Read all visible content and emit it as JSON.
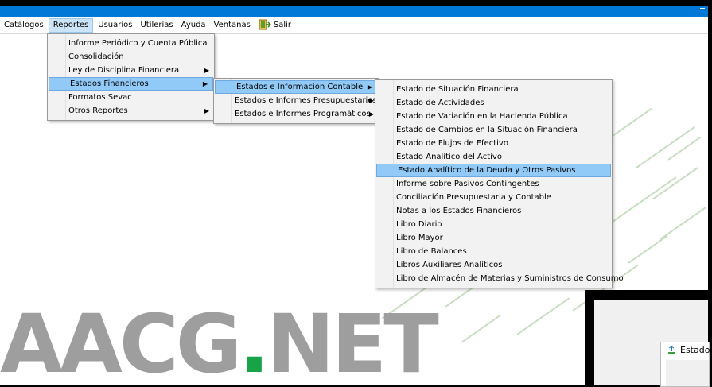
{
  "menubar": {
    "items": [
      "Catálogos",
      "Reportes",
      "Usuarios",
      "Utilerías",
      "Ayuda",
      "Ventanas",
      "Salir"
    ]
  },
  "menus": {
    "reportes": [
      {
        "label": "Informe Periódico y Cuenta Pública",
        "submenu": false
      },
      {
        "label": "Consolidación",
        "submenu": false
      },
      {
        "label": "Ley de Disciplina Financiera",
        "submenu": true
      },
      {
        "label": "Estados Financieros",
        "submenu": true,
        "highlighted": true
      },
      {
        "label": "Formatos Sevac",
        "submenu": false
      },
      {
        "label": "Otros Reportes",
        "submenu": true
      }
    ],
    "estados_financieros": [
      {
        "label": "Estados e Información Contable",
        "submenu": true,
        "highlighted": true
      },
      {
        "label": "Estados e Informes Presupuestarios",
        "submenu": true
      },
      {
        "label": "Estados e Informes Programáticos",
        "submenu": true
      }
    ],
    "contable": [
      {
        "label": "Estado de Situación Financiera"
      },
      {
        "label": "Estado de Actividades"
      },
      {
        "label": "Estado de Variación en la Hacienda Pública"
      },
      {
        "label": "Estado de Cambios en la Situación Financiera"
      },
      {
        "label": "Estado de Flujos de Efectivo"
      },
      {
        "label": "Estado Analítico del Activo"
      },
      {
        "label": "Estado Analítico de la Deuda y Otros Pasivos",
        "highlighted": true
      },
      {
        "label": "Informe sobre Pasivos Contingentes"
      },
      {
        "label": "Conciliación Presupuestaria y Contable"
      },
      {
        "label": "Notas a los Estados Financieros"
      },
      {
        "label": "Libro Diario"
      },
      {
        "label": "Libro Mayor"
      },
      {
        "label": "Libro de Balances"
      },
      {
        "label": "Libros Auxiliares Analíticos"
      },
      {
        "label": "Libro de Almacén de Materias y Suministros de Consumo"
      }
    ]
  },
  "logo": {
    "before": "AACG",
    "dot": ".",
    "after": "NET"
  },
  "dialog": {
    "title": "Estado"
  },
  "colors": {
    "titlebar": "#0078d7",
    "highlight": "#91c9f7",
    "logo_gray": "#9e9e9e",
    "logo_green": "#18a349"
  }
}
